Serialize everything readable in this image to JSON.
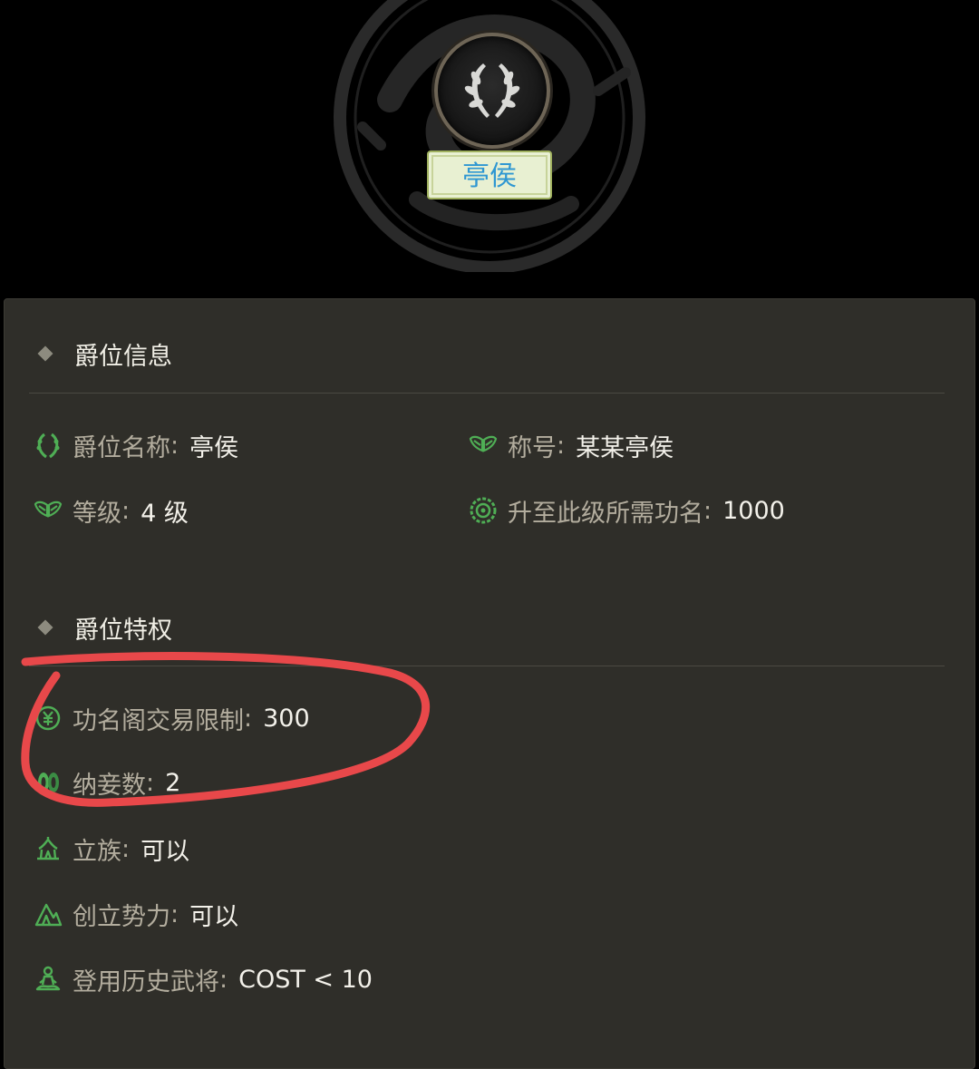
{
  "hero": {
    "rank_name": "亭侯"
  },
  "sections": {
    "info_title": "爵位信息",
    "privilege_title": "爵位特权"
  },
  "info": {
    "rank_name_label": "爵位名称",
    "rank_name_value": "亭侯",
    "title_label": "称号",
    "title_value": "某某亭侯",
    "level_label": "等级",
    "level_value": "4 级",
    "merit_label": "升至此级所需功名",
    "merit_value": "1000"
  },
  "privileges": {
    "trade_label": "功名阁交易限制",
    "trade_value": "300",
    "concubine_label": "纳妾数",
    "concubine_value": "2",
    "clan_label": "立族",
    "clan_value": "可以",
    "faction_label": "创立势力",
    "faction_value": "可以",
    "general_label": "登用历史武将",
    "general_value": "COST < 10"
  },
  "separator": ":",
  "colors": {
    "panel_bg": "#2f2e29",
    "icon_green": "#4fae55",
    "annotation_red": "#e8484a",
    "tag_text": "#2f97d2"
  },
  "icons": [
    "laurel-icon",
    "wings-icon",
    "medal-icon",
    "coin-icon",
    "pair-icon",
    "tent-icon",
    "mountain-icon",
    "meditate-icon"
  ]
}
